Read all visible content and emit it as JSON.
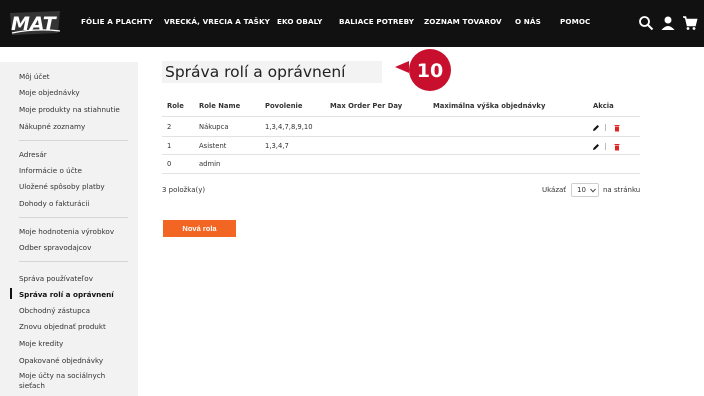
{
  "header": {
    "logo_text": "MAT",
    "nav": [
      "FÓLIE A PLACHTY",
      "VRECKÁ, VRECIA A TAŠKY",
      "EKO OBALY",
      "BALIACE POTREBY",
      "ZOZNAM TOVAROV",
      "O NÁS",
      "POMOC"
    ],
    "icons": [
      "search-icon",
      "user-icon",
      "cart-icon"
    ]
  },
  "sidebar": {
    "group1": [
      "Môj účet",
      "Moje objednávky",
      "Moje produkty na stiahnutie",
      "Nákupné zoznamy"
    ],
    "group2": [
      "Adresár",
      "Informácie o účte",
      "Uložené spôsoby platby",
      "Dohody o fakturácii"
    ],
    "group3": [
      "Moje hodnotenia výrobkov",
      "Odber spravodajcov"
    ],
    "group4": [
      "Správa používateľov",
      "Správa rolí a oprávnení",
      "Obchodný zástupca",
      "Znovu objednať produkt",
      "Moje kredity",
      "Opakované objednávky",
      "Moje účty na sociálnych sieťach"
    ],
    "active": "Správa rolí a oprávnení"
  },
  "main": {
    "title": "Správa rolí a oprávnení",
    "step_badge": "10",
    "table": {
      "headers": [
        "Role",
        "Role Name",
        "Povolenie",
        "Max Order Per Day",
        "Maximálna výška objednávky",
        "Akcia"
      ],
      "rows": [
        {
          "role": "2",
          "name": "Nákupca",
          "permissions": "1,3,4,7,8,9,10"
        },
        {
          "role": "1",
          "name": "Asistent",
          "permissions": "1,3,4,7"
        },
        {
          "role": "0",
          "name": "admin",
          "permissions": ""
        }
      ]
    },
    "count_text": "3 položka(y)",
    "show_label": "Ukázať",
    "per_page_value": "10",
    "per_page_suffix": "na stránku",
    "new_role_button": "Nová rola"
  },
  "colors": {
    "topbar": "#111111",
    "accent": "#f26522",
    "badge": "#c8102e",
    "delete": "#e02424"
  }
}
